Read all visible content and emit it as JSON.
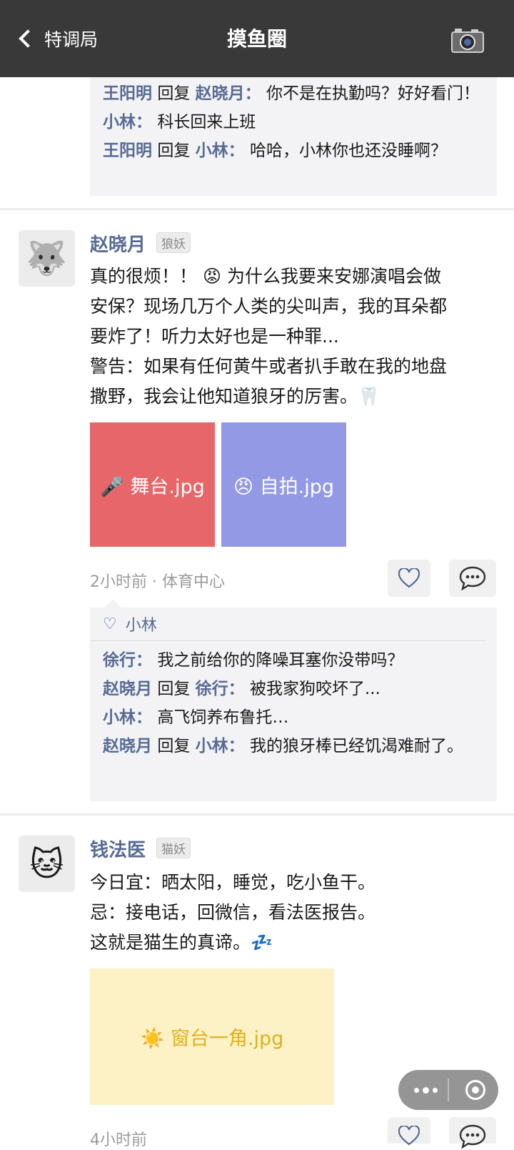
{
  "header": {
    "back_label": "特调局",
    "title": "摸鱼圈"
  },
  "top_comments": [
    {
      "name": "王阳明",
      "reply_word": "回复",
      "reply_to": "赵晓月",
      "colon": "：",
      "text": "你不是在执勤吗？好好看门！"
    },
    {
      "name": "小林",
      "colon": "：",
      "text": "科长回来上班"
    },
    {
      "name": "王阳明",
      "reply_word": "回复",
      "reply_to": "小林",
      "colon": "：",
      "text": "哈哈，小林你也还没睡啊？"
    }
  ],
  "post1": {
    "name": "赵晓月",
    "tag": "狼妖",
    "avatar_emoji": "🐺",
    "lines": [
      "真的很烦！！ 😡 为什么我要来安娜演唱会做",
      "安保？现场几万个人类的尖叫声，我的耳朵都",
      "要炸了！听力太好也是一种罪...",
      "警告：如果有任何黄牛或者扒手敢在我的地盘",
      "撒野，我会让他知道狼牙的厉害。🦷"
    ],
    "images": [
      {
        "label": "🎤 舞台.jpg",
        "bg": "#e76669",
        "fg": "#ffffff"
      },
      {
        "label": "😠 自拍.jpg",
        "bg": "#9499e6",
        "fg": "#ffffff"
      }
    ],
    "time": "2小时前",
    "location": "体育中心",
    "likes": "小林",
    "comments": [
      {
        "name": "徐行",
        "colon": "：",
        "text": "我之前给你的降噪耳塞你没带吗？"
      },
      {
        "name": "赵晓月",
        "reply_word": "回复",
        "reply_to": "徐行",
        "colon": "：",
        "text": "被我家狗咬坏了..."
      },
      {
        "name": "小林",
        "colon": "：",
        "text": "高飞饲养布鲁托…"
      },
      {
        "name": "赵晓月",
        "reply_word": "回复",
        "reply_to": "小林",
        "colon": "：",
        "text": "我的狼牙棒已经饥渴难耐了。"
      }
    ]
  },
  "post2": {
    "name": "钱法医",
    "tag": "猫妖",
    "avatar_emoji": "🐱",
    "lines": [
      "今日宜：晒太阳，睡觉，吃小鱼干。",
      "忌：接电话，回微信，看法医报告。",
      "这就是猫生的真谛。💤"
    ],
    "images": [
      {
        "label": "☀️ 窗台一角.jpg",
        "bg": "#fdf2c6",
        "fg": "#e0b020"
      }
    ],
    "time": "4小时前"
  },
  "colors": {
    "header_bg": "#393939",
    "link": "#576b95",
    "comment_bg": "#f3f3f5"
  }
}
